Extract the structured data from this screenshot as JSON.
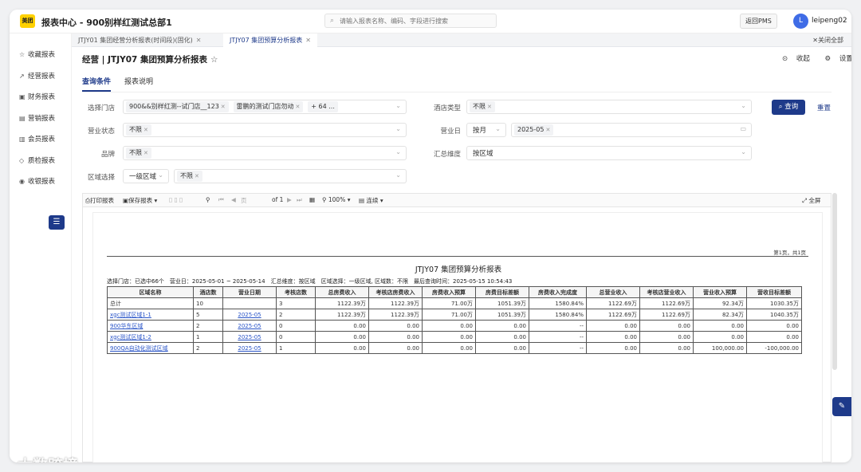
{
  "app": {
    "logo": "美团",
    "title": "报表中心 - 900别样红测试总部1",
    "search_placeholder": "请输入报表名称、编码、字段进行搜索",
    "back_pms": "返回PMS",
    "avatar_letter": "L",
    "username": "leipeng02"
  },
  "sidebar": {
    "items": [
      {
        "icon": "star-icon",
        "label": "收藏报表"
      },
      {
        "icon": "chart-line-icon",
        "label": "经营报表"
      },
      {
        "icon": "finance-icon",
        "label": "财务报表"
      },
      {
        "icon": "marketing-icon",
        "label": "营销报表"
      },
      {
        "icon": "member-icon",
        "label": "会员报表"
      },
      {
        "icon": "shield-icon",
        "label": "质检报表"
      },
      {
        "icon": "cashier-icon",
        "label": "收银报表"
      }
    ]
  },
  "tabs": [
    {
      "label": "JTJY01 集团经营分析报表(时间段)(固化)",
      "active": false
    },
    {
      "label": "JTJY07 集团预算分析报表",
      "active": true
    }
  ],
  "close_all": "关闭全部",
  "header": {
    "title": "经营 | JTJY07 集团预算分析报表",
    "star": "☆",
    "collapse": "收起",
    "settings": "设置"
  },
  "subtabs": [
    {
      "label": "查询条件",
      "active": true
    },
    {
      "label": "报表说明",
      "active": false
    }
  ],
  "filters": {
    "store_label": "选择门店",
    "store_tags": [
      "900&&别样红测--试门店__123",
      "雷鹏的测试门店勿动"
    ],
    "store_more": "+ 64 ...",
    "hotel_type_label": "酒店类型",
    "hotel_type_tag": "不限",
    "status_label": "营业状态",
    "status_tag": "不限",
    "bizday_label": "营业日",
    "bizday_mode": "按月",
    "bizday_tag": "2025-05",
    "brand_label": "品牌",
    "brand_tag": "不限",
    "dimension_label": "汇总维度",
    "dimension_value": "按区域",
    "region_label": "区域选择",
    "region_level": "一级区域",
    "region_tag": "不限",
    "query": "查询",
    "reset": "重置"
  },
  "toolbar": {
    "print": "打印报表",
    "save": "保存报表",
    "page_placeholder": "页",
    "page_total": "of 1",
    "zoom": "100%",
    "mode": "连续",
    "fullscreen": "全屏"
  },
  "report": {
    "page_num": "第1页，共1页",
    "title": "JTJY07 集团预算分析报表",
    "info": "选择门店：已选中66个　营业日：2025-05-01 ~ 2025-05-14　汇总维度：按区域　区域选择：一级区域, 区域数：不限　最后查询时间：2025-05-15 10:54:43",
    "headers": [
      "区域名称",
      "酒店数",
      "营业日期",
      "考核店数",
      "总房费收入",
      "考核店房费收入",
      "房费收入预算",
      "房费目标差额",
      "房费收入完成度",
      "总营业收入",
      "考核店营业收入",
      "营业收入预算",
      "营收目标差额"
    ],
    "rows": [
      [
        "总计",
        "10",
        "",
        "3",
        "1122.39万",
        "1122.39万",
        "71.00万",
        "1051.39万",
        "1580.84%",
        "1122.69万",
        "1122.69万",
        "92.34万",
        "1030.35万"
      ],
      [
        "xgc测试区域1-1",
        "5",
        "2025-05",
        "2",
        "1122.39万",
        "1122.39万",
        "71.00万",
        "1051.39万",
        "1580.84%",
        "1122.69万",
        "1122.69万",
        "82.34万",
        "1040.35万"
      ],
      [
        "900华东区域",
        "2",
        "2025-05",
        "0",
        "0.00",
        "0.00",
        "0.00",
        "0.00",
        "--",
        "0.00",
        "0.00",
        "0.00",
        "0.00"
      ],
      [
        "xgc测试区域1-2",
        "1",
        "2025-05",
        "0",
        "0.00",
        "0.00",
        "0.00",
        "0.00",
        "--",
        "0.00",
        "0.00",
        "0.00",
        "0.00"
      ],
      [
        "900QA自动化测试区域",
        "2",
        "2025-05",
        "1",
        "0.00",
        "0.00",
        "0.00",
        "0.00",
        "--",
        "0.00",
        "0.00",
        "100,000.00",
        "-100,000.00"
      ]
    ]
  },
  "watermark": "大数跨境",
  "colors": {
    "primary": "#1e3a8a",
    "brand_yellow": "#ffd100",
    "link": "#2a55c8"
  }
}
